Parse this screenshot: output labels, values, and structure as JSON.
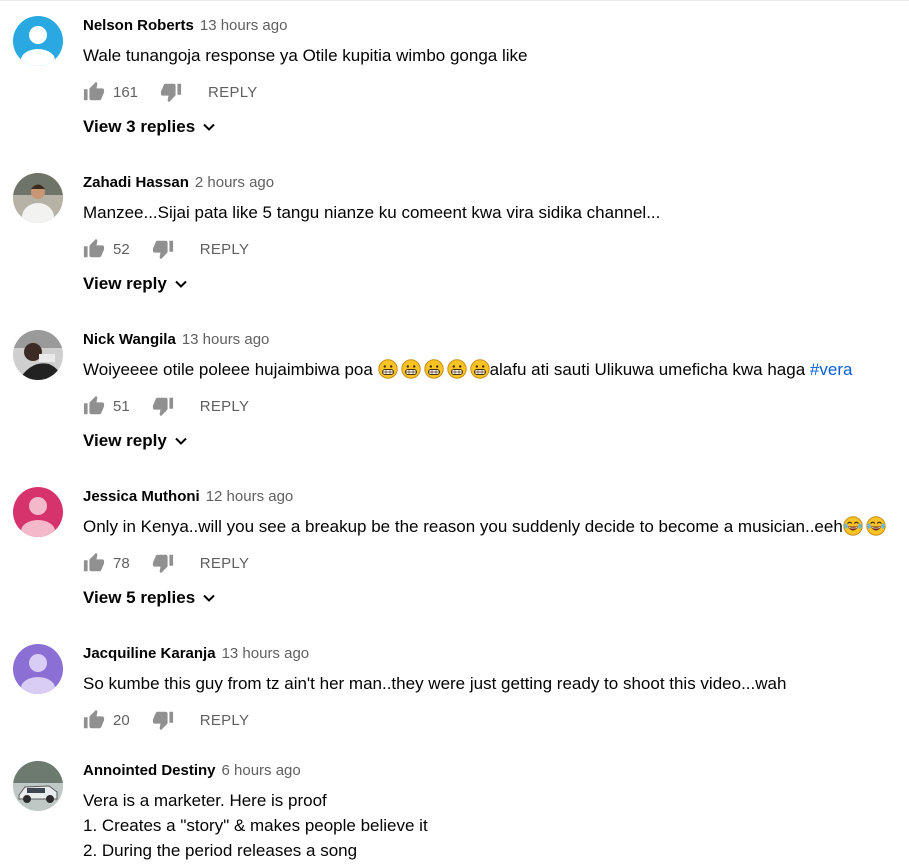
{
  "comments": [
    {
      "author": "Nelson Roberts",
      "time": "13 hours ago",
      "text": "Wale tunangoja response ya Otile kupitia wimbo gonga like",
      "likes": "161",
      "reply_label": "REPLY",
      "view_replies": "View 3 replies",
      "avatar_color": "#29a8e2"
    },
    {
      "author": "Zahadi Hassan",
      "time": "2 hours ago",
      "text": "Manzee...Sijai pata like 5 tangu nianze ku comeent kwa vira sidika channel...",
      "likes": "52",
      "reply_label": "REPLY",
      "view_replies": "View reply"
    },
    {
      "author": "Nick Wangila",
      "time": "13 hours ago",
      "text_before": "Woiyeeee otile poleee hujaimbiwa poa",
      "text_after": "alafu ati sauti Ulikuwa umeficha kwa haga",
      "hashtag": "#vera",
      "likes": "51",
      "reply_label": "REPLY",
      "view_replies": "View reply"
    },
    {
      "author": "Jessica Muthoni",
      "time": "12 hours ago",
      "text": "Only in Kenya..will you see a breakup be the reason you suddenly decide to become a musician..eeh",
      "likes": "78",
      "reply_label": "REPLY",
      "view_replies": "View 5 replies",
      "avatar_color": "#d6336c"
    },
    {
      "author": "Jacquiline Karanja",
      "time": "13 hours ago",
      "text": "So kumbe this guy from tz ain't her man..they were just getting ready to shoot this video...wah",
      "likes": "20",
      "reply_label": "REPLY",
      "avatar_color": "#8b6fd4"
    },
    {
      "author": "Annointed Destiny",
      "time": "6 hours ago",
      "lines": [
        "Vera is a marketer. Here is proof",
        "1. Creates a \"story\" & makes people believe it",
        "2. During the period releases a song"
      ]
    }
  ],
  "colors": {
    "secondary_text": "#606060",
    "hashtag": "#065fd4"
  },
  "icons": [
    "like-icon",
    "dislike-icon",
    "chevron-down-icon",
    "grinning-emoji",
    "laughing-emoji"
  ]
}
